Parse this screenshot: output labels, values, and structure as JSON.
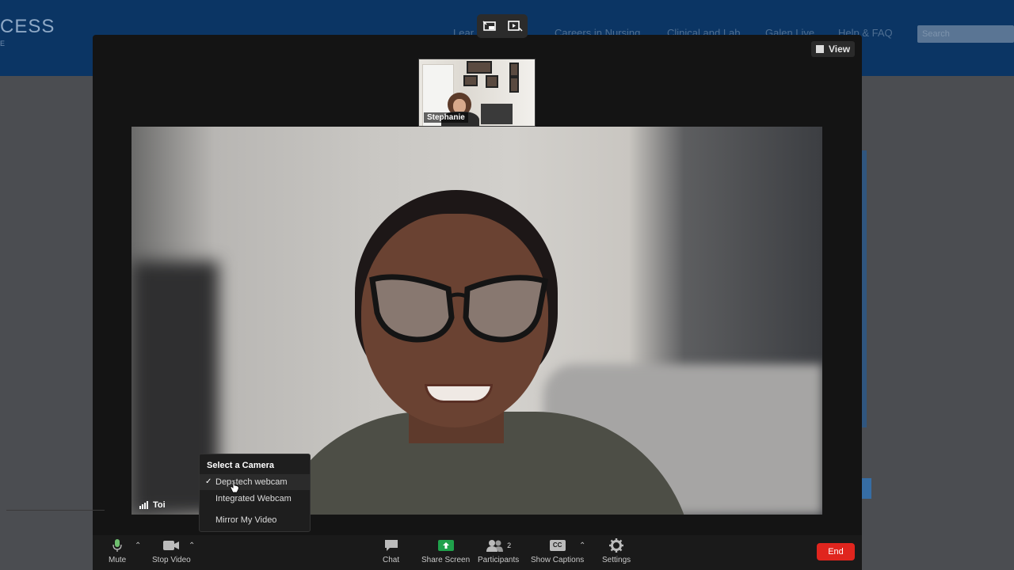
{
  "website": {
    "logo_text": "CESS",
    "logo_sub": "E",
    "nav": [
      "Lear",
      "Careers in Nursing",
      "Clinical and Lab",
      "Galen Live",
      "Help & FAQ"
    ],
    "search_placeholder": "Search",
    "header_color": "#0b3564"
  },
  "meeting": {
    "top_controls": [
      "swap-view-icon",
      "fullscreen-icon"
    ],
    "view_label": "View",
    "thumbnail": {
      "name": "Stephanie"
    },
    "main_speaker": {
      "name": "Toi"
    }
  },
  "camera_menu": {
    "title": "Select a Camera",
    "options": [
      {
        "label": "Depstech webcam",
        "selected": true
      },
      {
        "label": "Integrated Webcam",
        "selected": false
      }
    ],
    "mirror_label": "Mirror My Video"
  },
  "toolbar": {
    "mute": "Mute",
    "stop_video": "Stop Video",
    "chat": "Chat",
    "share_screen": "Share Screen",
    "participants": "Participants",
    "participants_count": "2",
    "show_captions": "Show Captions",
    "cc_badge": "CC",
    "settings": "Settings",
    "end": "End",
    "share_color": "#1fa14b",
    "end_color": "#e0251e"
  }
}
